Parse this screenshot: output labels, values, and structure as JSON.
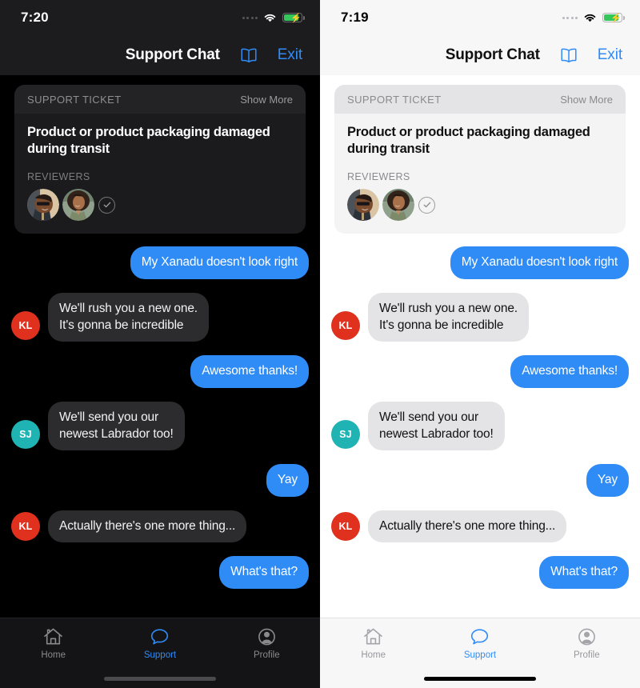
{
  "panels": [
    {
      "theme": "dark",
      "status": {
        "time": "7:20",
        "wifi": "wifi-icon",
        "battery": "battery-charging-icon",
        "signal": "signal-dots-icon"
      },
      "nav": {
        "title": "Support Chat",
        "book_icon": "book-icon",
        "exit_label": "Exit"
      },
      "ticket": {
        "kicker": "SUPPORT TICKET",
        "show_more": "Show More",
        "title": "Product or product packaging damaged during transit",
        "reviewers_label": "REVIEWERS",
        "reviewers": [
          {
            "name": "reviewer-avatar-1"
          },
          {
            "name": "reviewer-avatar-2"
          }
        ],
        "check_icon": "check-circle-icon"
      },
      "messages": [
        {
          "side": "out",
          "text": "My Xanadu doesn't look right"
        },
        {
          "side": "in",
          "initials": "KL",
          "avatar_color": "#e0301e",
          "text": "We'll rush you a new one.\nIt's gonna be incredible"
        },
        {
          "side": "out",
          "text": "Awesome thanks!"
        },
        {
          "side": "in",
          "initials": "SJ",
          "avatar_color": "#1fb3b3",
          "text": "We'll send you our\nnewest Labrador too!"
        },
        {
          "side": "out",
          "text": "Yay"
        },
        {
          "side": "in",
          "initials": "KL",
          "avatar_color": "#e0301e",
          "text": "Actually there's one more thing..."
        },
        {
          "side": "out",
          "text": "What's that?"
        }
      ],
      "tabs": [
        {
          "label": "Home",
          "icon": "home-icon",
          "active": false
        },
        {
          "label": "Support",
          "icon": "chat-bubble-icon",
          "active": true
        },
        {
          "label": "Profile",
          "icon": "person-circle-icon",
          "active": false
        }
      ]
    },
    {
      "theme": "light",
      "status": {
        "time": "7:19",
        "wifi": "wifi-icon",
        "battery": "battery-charging-icon",
        "signal": "signal-dots-icon"
      },
      "nav": {
        "title": "Support Chat",
        "book_icon": "book-icon",
        "exit_label": "Exit"
      },
      "ticket": {
        "kicker": "SUPPORT TICKET",
        "show_more": "Show More",
        "title": "Product or product packaging damaged during transit",
        "reviewers_label": "REVIEWERS",
        "reviewers": [
          {
            "name": "reviewer-avatar-1"
          },
          {
            "name": "reviewer-avatar-2"
          }
        ],
        "check_icon": "check-circle-icon"
      },
      "messages": [
        {
          "side": "out",
          "text": "My Xanadu doesn't look right"
        },
        {
          "side": "in",
          "initials": "KL",
          "avatar_color": "#e0301e",
          "text": "We'll rush you a new one.\nIt's gonna be incredible"
        },
        {
          "side": "out",
          "text": "Awesome thanks!"
        },
        {
          "side": "in",
          "initials": "SJ",
          "avatar_color": "#1fb3b3",
          "text": "We'll send you our\nnewest Labrador too!"
        },
        {
          "side": "out",
          "text": "Yay"
        },
        {
          "side": "in",
          "initials": "KL",
          "avatar_color": "#e0301e",
          "text": "Actually there's one more thing..."
        },
        {
          "side": "out",
          "text": "What's that?"
        }
      ],
      "tabs": [
        {
          "label": "Home",
          "icon": "home-icon",
          "active": false
        },
        {
          "label": "Support",
          "icon": "chat-bubble-icon",
          "active": true
        },
        {
          "label": "Profile",
          "icon": "person-circle-icon",
          "active": false
        }
      ]
    }
  ],
  "colors": {
    "accent_blue": "#2f8cf7",
    "battery_green": "#34c759",
    "avatar_red": "#e0301e",
    "avatar_teal": "#1fb3b3"
  }
}
